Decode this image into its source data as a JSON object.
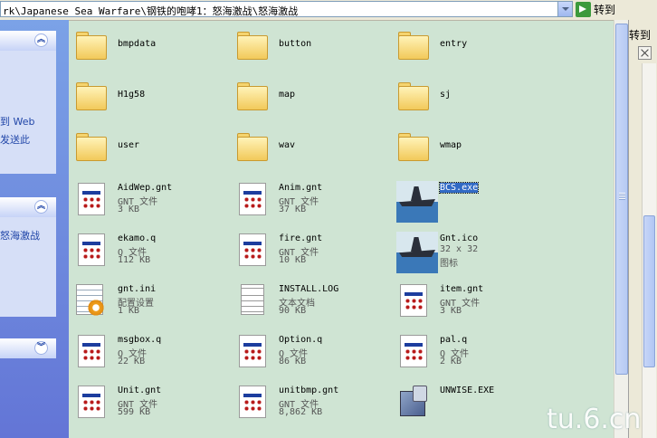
{
  "address": {
    "path": "rk\\Japanese Sea Warfare\\钢铁的咆哮1：怒海激战\\怒海激战",
    "go_label": "转到"
  },
  "second_window": {
    "title": "转到"
  },
  "task_pane": {
    "link_text_1": "到 Web",
    "link_text_2": "发送此",
    "place_text": "怒海激战"
  },
  "files": [
    {
      "name": "bmpdata",
      "icon": "folder"
    },
    {
      "name": "button",
      "icon": "folder"
    },
    {
      "name": "entry",
      "icon": "folder"
    },
    {
      "name": "H1g58",
      "icon": "folder"
    },
    {
      "name": "map",
      "icon": "folder"
    },
    {
      "name": "sj",
      "icon": "folder"
    },
    {
      "name": "user",
      "icon": "folder"
    },
    {
      "name": "wav",
      "icon": "folder"
    },
    {
      "name": "wmap",
      "icon": "folder"
    },
    {
      "name": "AidWep.gnt",
      "type": "GNT 文件",
      "size": "3 KB",
      "icon": "gnt-window"
    },
    {
      "name": "Anim.gnt",
      "type": "GNT 文件",
      "size": "37 KB",
      "icon": "gnt-window"
    },
    {
      "name": "BCS.exe",
      "icon": "battleship",
      "selected": true
    },
    {
      "name": "ekamo.q",
      "type": "Q 文件",
      "size": "112 KB",
      "icon": "gnt-window"
    },
    {
      "name": "fire.gnt",
      "type": "GNT 文件",
      "size": "10 KB",
      "icon": "gnt-window"
    },
    {
      "name": "Gnt.ico",
      "type": "32 x 32",
      "size": "图标",
      "icon": "battleship"
    },
    {
      "name": "gnt.ini",
      "type": "配置设置",
      "size": "1 KB",
      "icon": "ini-gear"
    },
    {
      "name": "INSTALL.LOG",
      "type": "文本文档",
      "size": "90 KB",
      "icon": "text-file"
    },
    {
      "name": "item.gnt",
      "type": "GNT 文件",
      "size": "3 KB",
      "icon": "gnt-window"
    },
    {
      "name": "msgbox.q",
      "type": "Q 文件",
      "size": "22 KB",
      "icon": "gnt-window"
    },
    {
      "name": "Option.q",
      "type": "Q 文件",
      "size": "86 KB",
      "icon": "gnt-window"
    },
    {
      "name": "pal.q",
      "type": "Q 文件",
      "size": "2 KB",
      "icon": "gnt-window"
    },
    {
      "name": "Unit.gnt",
      "type": "GNT 文件",
      "size": "599 KB",
      "icon": "gnt-window"
    },
    {
      "name": "unitbmp.gnt",
      "type": "GNT 文件",
      "size": "8,862 KB",
      "icon": "gnt-window"
    },
    {
      "name": "UNWISE.EXE",
      "icon": "installer"
    }
  ],
  "watermark": "tu.6.cn"
}
